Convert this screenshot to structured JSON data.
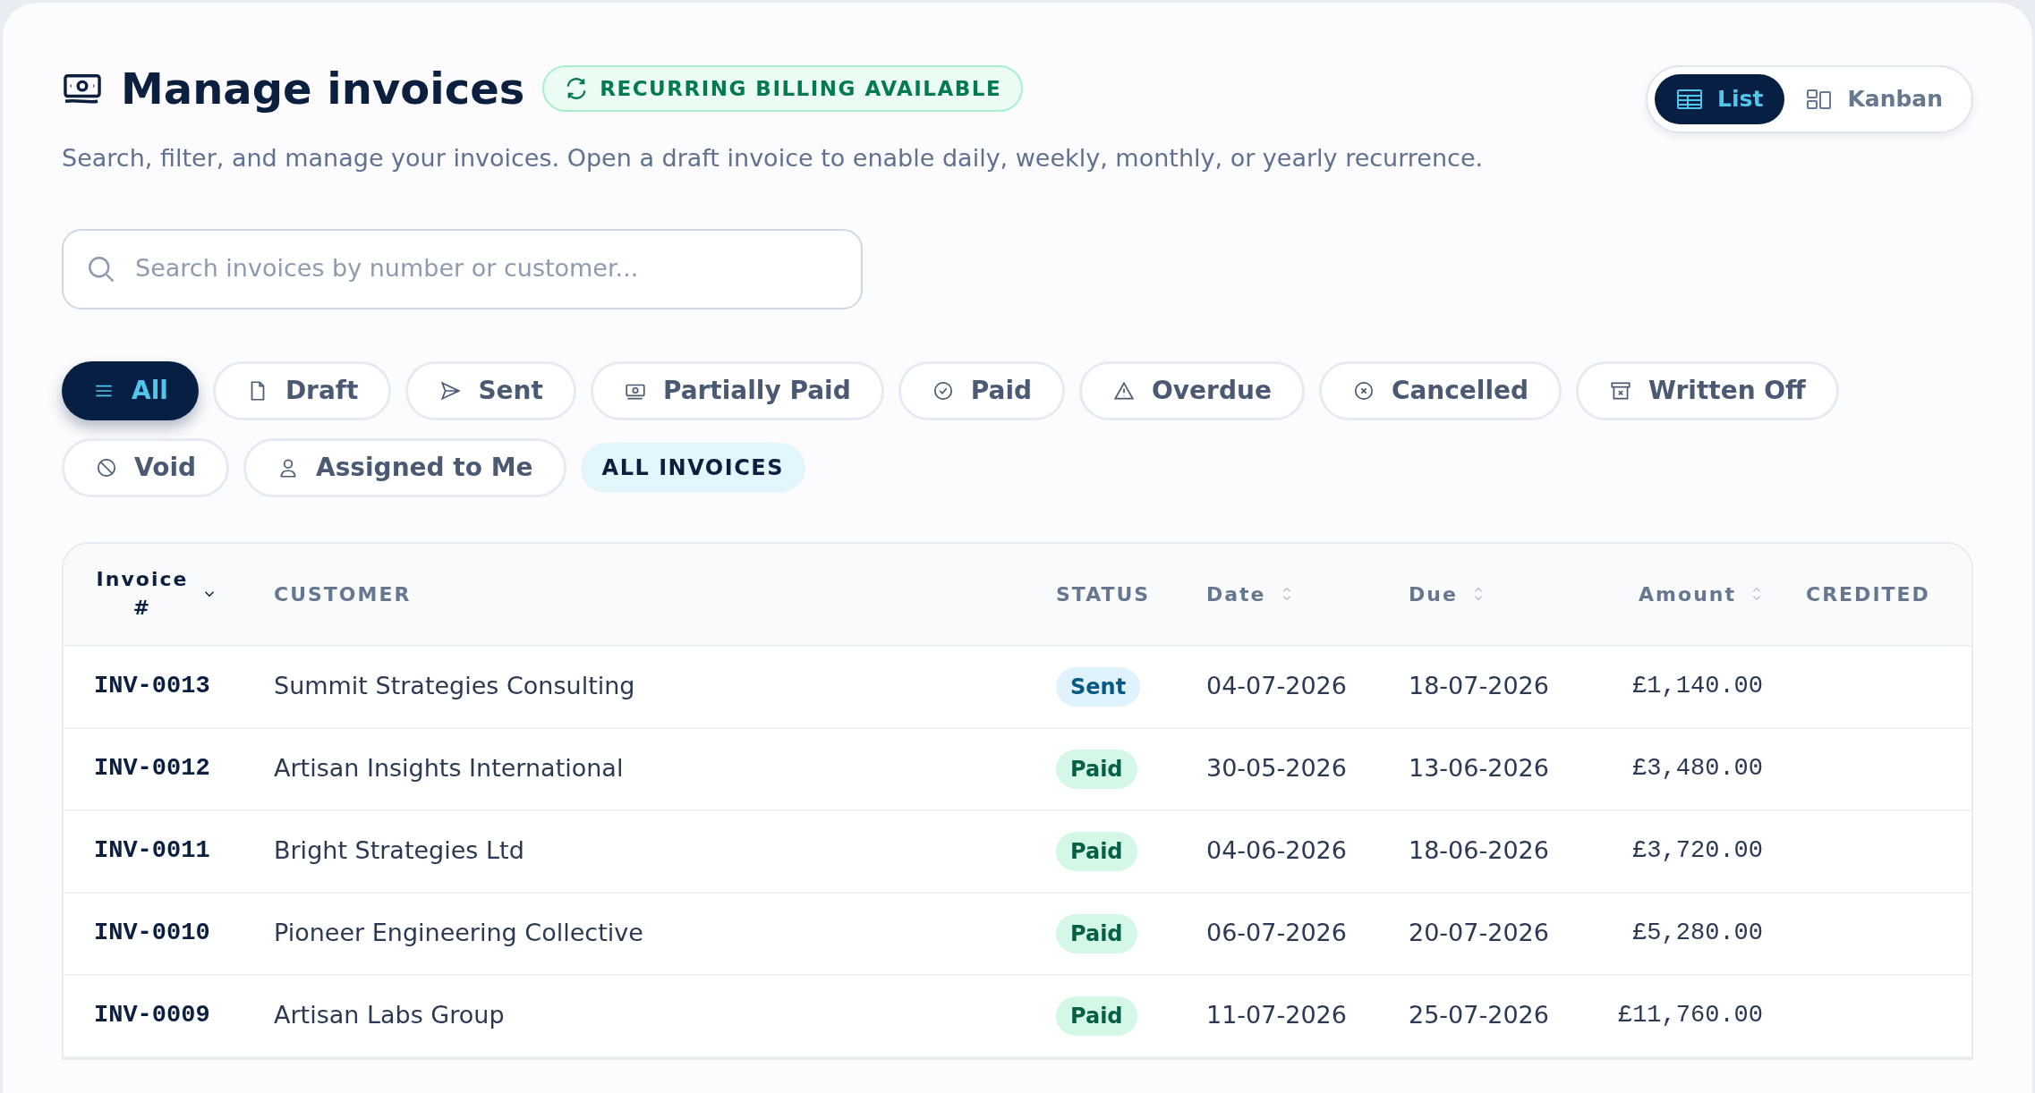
{
  "header": {
    "title": "Manage invoices",
    "badge": "RECURRING BILLING AVAILABLE",
    "subtitle": "Search, filter, and manage your invoices. Open a draft invoice to enable daily, weekly, monthly, or yearly recurrence."
  },
  "view_toggle": [
    {
      "label": "List",
      "selected": true
    },
    {
      "label": "Kanban",
      "selected": false
    }
  ],
  "search": {
    "placeholder": "Search invoices by number or customer..."
  },
  "filters": [
    {
      "kind": "filter",
      "label": "All",
      "selected": true
    },
    {
      "kind": "filter",
      "label": "Draft",
      "selected": false
    },
    {
      "kind": "filter",
      "label": "Sent",
      "selected": false
    },
    {
      "kind": "filter",
      "label": "Partially Paid",
      "selected": false
    },
    {
      "kind": "filter",
      "label": "Paid",
      "selected": false
    },
    {
      "kind": "filter",
      "label": "Overdue",
      "selected": false
    },
    {
      "kind": "filter",
      "label": "Cancelled",
      "selected": false
    },
    {
      "kind": "filter",
      "label": "Written Off",
      "selected": false
    },
    {
      "kind": "filter",
      "label": "Void",
      "selected": false
    },
    {
      "kind": "filter",
      "label": "Assigned to Me",
      "selected": false
    },
    {
      "kind": "tag",
      "label": "ALL INVOICES"
    }
  ],
  "table": {
    "columns": [
      {
        "label": "Invoice #",
        "kind": "sorted"
      },
      {
        "label": "CUSTOMER",
        "kind": "plain"
      },
      {
        "label": "STATUS",
        "kind": "plain"
      },
      {
        "label": "Date",
        "kind": "sortable"
      },
      {
        "label": "Due",
        "kind": "sortable"
      },
      {
        "label": "Amount",
        "kind": "sortable"
      },
      {
        "label": "CREDITED",
        "kind": "plain"
      }
    ],
    "rows": [
      {
        "invoice": "INV-0013",
        "customer": "Summit Strategies Consulting",
        "status": "Sent",
        "kind": "sent",
        "date": "04-07-2026",
        "due": "18-07-2026",
        "amount": "£1,140.00"
      },
      {
        "invoice": "INV-0012",
        "customer": "Artisan Insights International",
        "status": "Paid",
        "kind": "paid",
        "date": "30-05-2026",
        "due": "13-06-2026",
        "amount": "£3,480.00"
      },
      {
        "invoice": "INV-0011",
        "customer": "Bright Strategies Ltd",
        "status": "Paid",
        "kind": "paid",
        "date": "04-06-2026",
        "due": "18-06-2026",
        "amount": "£3,720.00"
      },
      {
        "invoice": "INV-0010",
        "customer": "Pioneer Engineering Collective",
        "status": "Paid",
        "kind": "paid",
        "date": "06-07-2026",
        "due": "20-07-2026",
        "amount": "£5,280.00"
      },
      {
        "invoice": "INV-0009",
        "customer": "Artisan Labs Group",
        "status": "Paid",
        "kind": "paid",
        "date": "11-07-2026",
        "due": "25-07-2026",
        "amount": "£11,760.00"
      }
    ]
  }
}
